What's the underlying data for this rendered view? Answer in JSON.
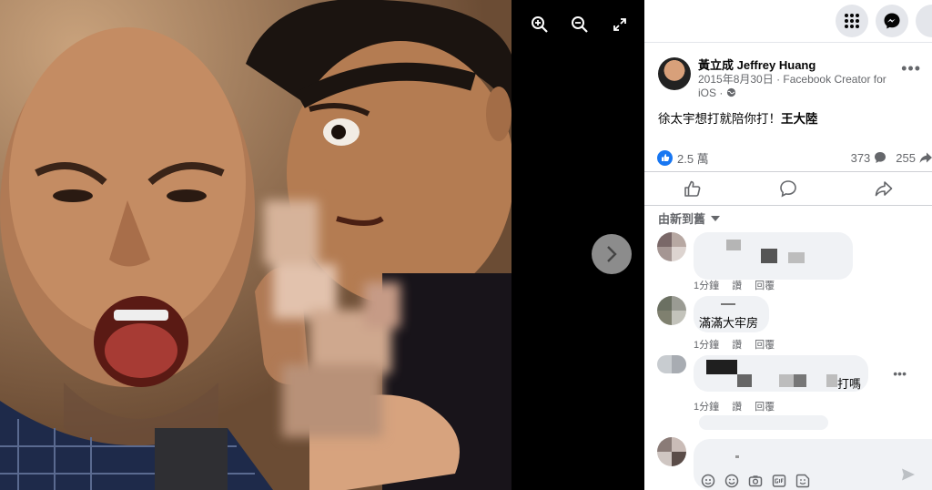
{
  "viewer": {
    "tools": [
      {
        "name": "zoom-in-icon"
      },
      {
        "name": "zoom-out-icon"
      },
      {
        "name": "fullscreen-icon"
      }
    ],
    "next_icon": "chevron-right-icon"
  },
  "topbar": {
    "icons": [
      "menu-grid-icon",
      "messenger-icon"
    ]
  },
  "post": {
    "author": "黃立成 Jeffrey Huang",
    "date": "2015年8月30日",
    "via": "Facebook Creator for",
    "platform": "iOS",
    "text": "徐太宇想打就陪你打！",
    "tag": "王大陸",
    "reactions_count": "2.5 萬",
    "comments_count": "373",
    "shares_count": "255"
  },
  "comments_section": {
    "sort_label": "由新到舊",
    "items": [
      {
        "text": "",
        "time": "1分鐘",
        "like": "讚",
        "reply": "回覆"
      },
      {
        "text": "滿滿大牢房",
        "time": "1分鐘",
        "like": "讚",
        "reply": "回覆"
      },
      {
        "text": "打嗎",
        "time": "1分鐘",
        "like": "讚",
        "reply": "回覆"
      }
    ]
  },
  "colors": {
    "accent": "#1877f2",
    "panel_bg": "#ffffff",
    "bubble_bg": "#f0f2f5",
    "secondary_text": "#65676b"
  }
}
